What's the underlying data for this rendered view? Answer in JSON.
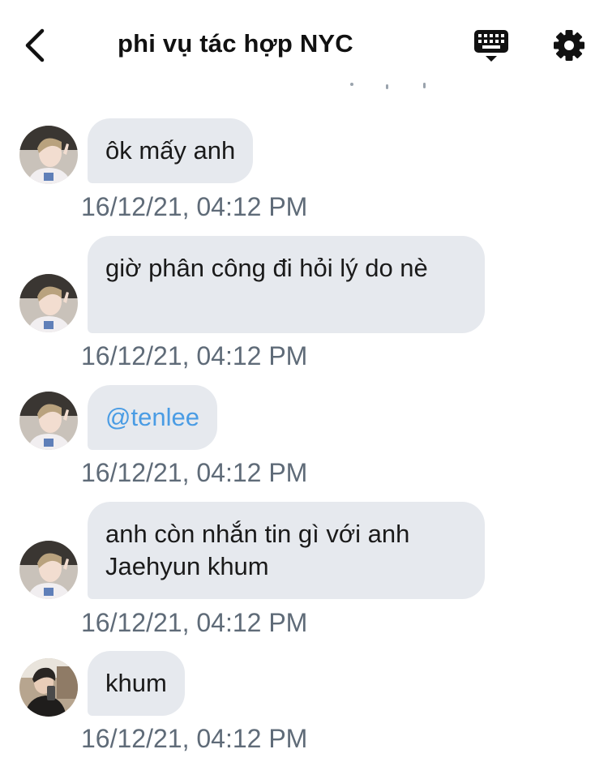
{
  "header": {
    "title": "phi vụ tác hợp NYC",
    "back_icon": "chevron-left-icon",
    "keyboard_icon": "keyboard-icon",
    "settings_icon": "gear-icon"
  },
  "messages": [
    {
      "sender": "user1",
      "text": "ôk mấy anh",
      "time": "16/12/21, 04:12 PM"
    },
    {
      "sender": "user1",
      "text": "giờ phân công đi hỏi lý do nè",
      "time": "16/12/21, 04:12 PM"
    },
    {
      "sender": "user1",
      "text": "@tenlee",
      "time": "16/12/21, 04:12 PM",
      "is_mention": true
    },
    {
      "sender": "user1",
      "text": "anh còn nhắn tin gì với anh Jaehyun khum",
      "time": "16/12/21, 04:12 PM"
    },
    {
      "sender": "user2",
      "text": "khum",
      "time": "16/12/21, 04:12 PM"
    }
  ],
  "colors": {
    "bubble_bg": "#e6e9ee",
    "mention": "#4a9ce4",
    "timestamp": "#5f6b78"
  }
}
